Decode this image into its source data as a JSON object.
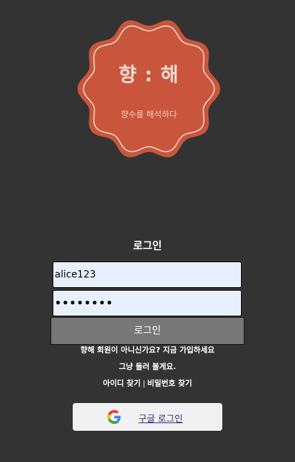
{
  "logo": {
    "title": "향 : 해",
    "subtitle": "향수를 해석하다",
    "badge_color": "#c9563c",
    "ring_color": "#f0d9cc"
  },
  "login": {
    "title": "로그인",
    "id_value": "alice123",
    "password_value": "••••••••",
    "button_label": "로그인"
  },
  "links": {
    "not_member": "향해 회원이 아니신가요?",
    "signup": "지금 가입하세요",
    "browse": "그냥 둘러 볼게요.",
    "find_id": "아이디 찾기",
    "separator": "|",
    "find_password": "비밀번호 찾기"
  },
  "google": {
    "label": "구글 로그인",
    "icon": "google-g-icon"
  }
}
